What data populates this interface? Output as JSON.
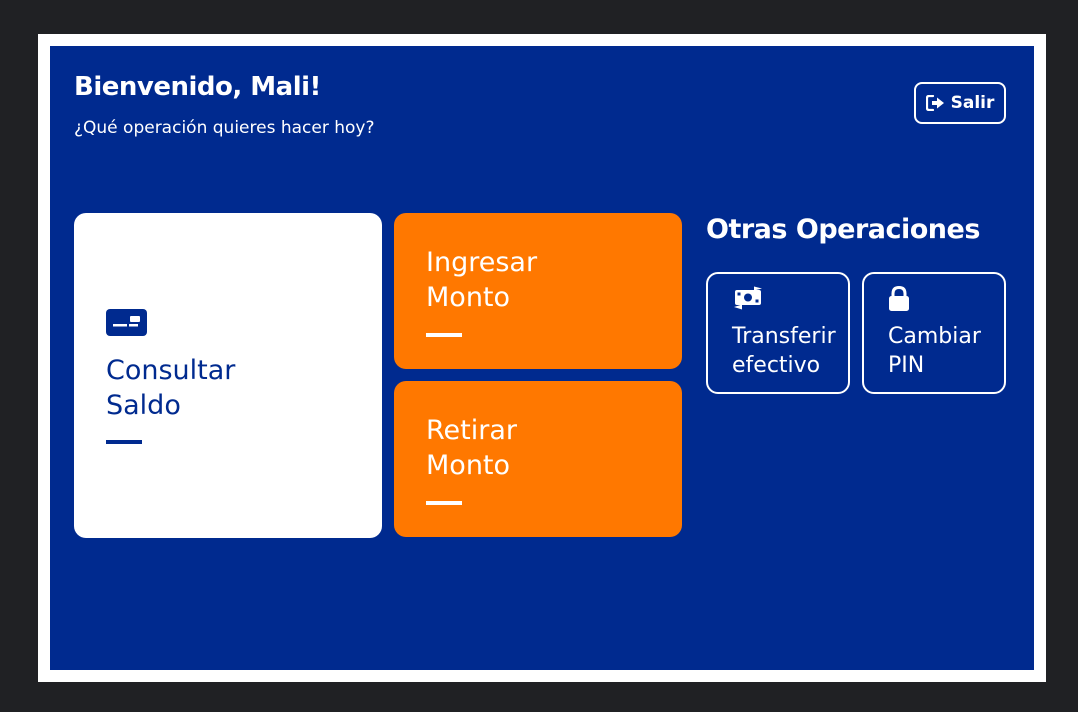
{
  "header": {
    "greeting": "Bienvenido, Mali!",
    "subtitle": "¿Qué operación quieres hacer hoy?",
    "logout_label": "Salir"
  },
  "main_actions": {
    "balance": {
      "line1": "Consultar",
      "line2": "Saldo",
      "icon": "id-card-icon"
    },
    "deposit": {
      "line1": "Ingresar",
      "line2": "Monto"
    },
    "withdraw": {
      "line1": "Retirar",
      "line2": "Monto"
    }
  },
  "other_operations": {
    "title": "Otras Operaciones",
    "items": [
      {
        "line1": "Transferir",
        "line2": "efectivo",
        "icon": "money-transfer-icon"
      },
      {
        "line1": "Cambiar",
        "line2": "PIN",
        "icon": "lock-icon"
      }
    ]
  },
  "colors": {
    "background": "#002a8f",
    "accent": "#ff7800",
    "card": "#ffffff",
    "frame_outer": "#202124"
  }
}
